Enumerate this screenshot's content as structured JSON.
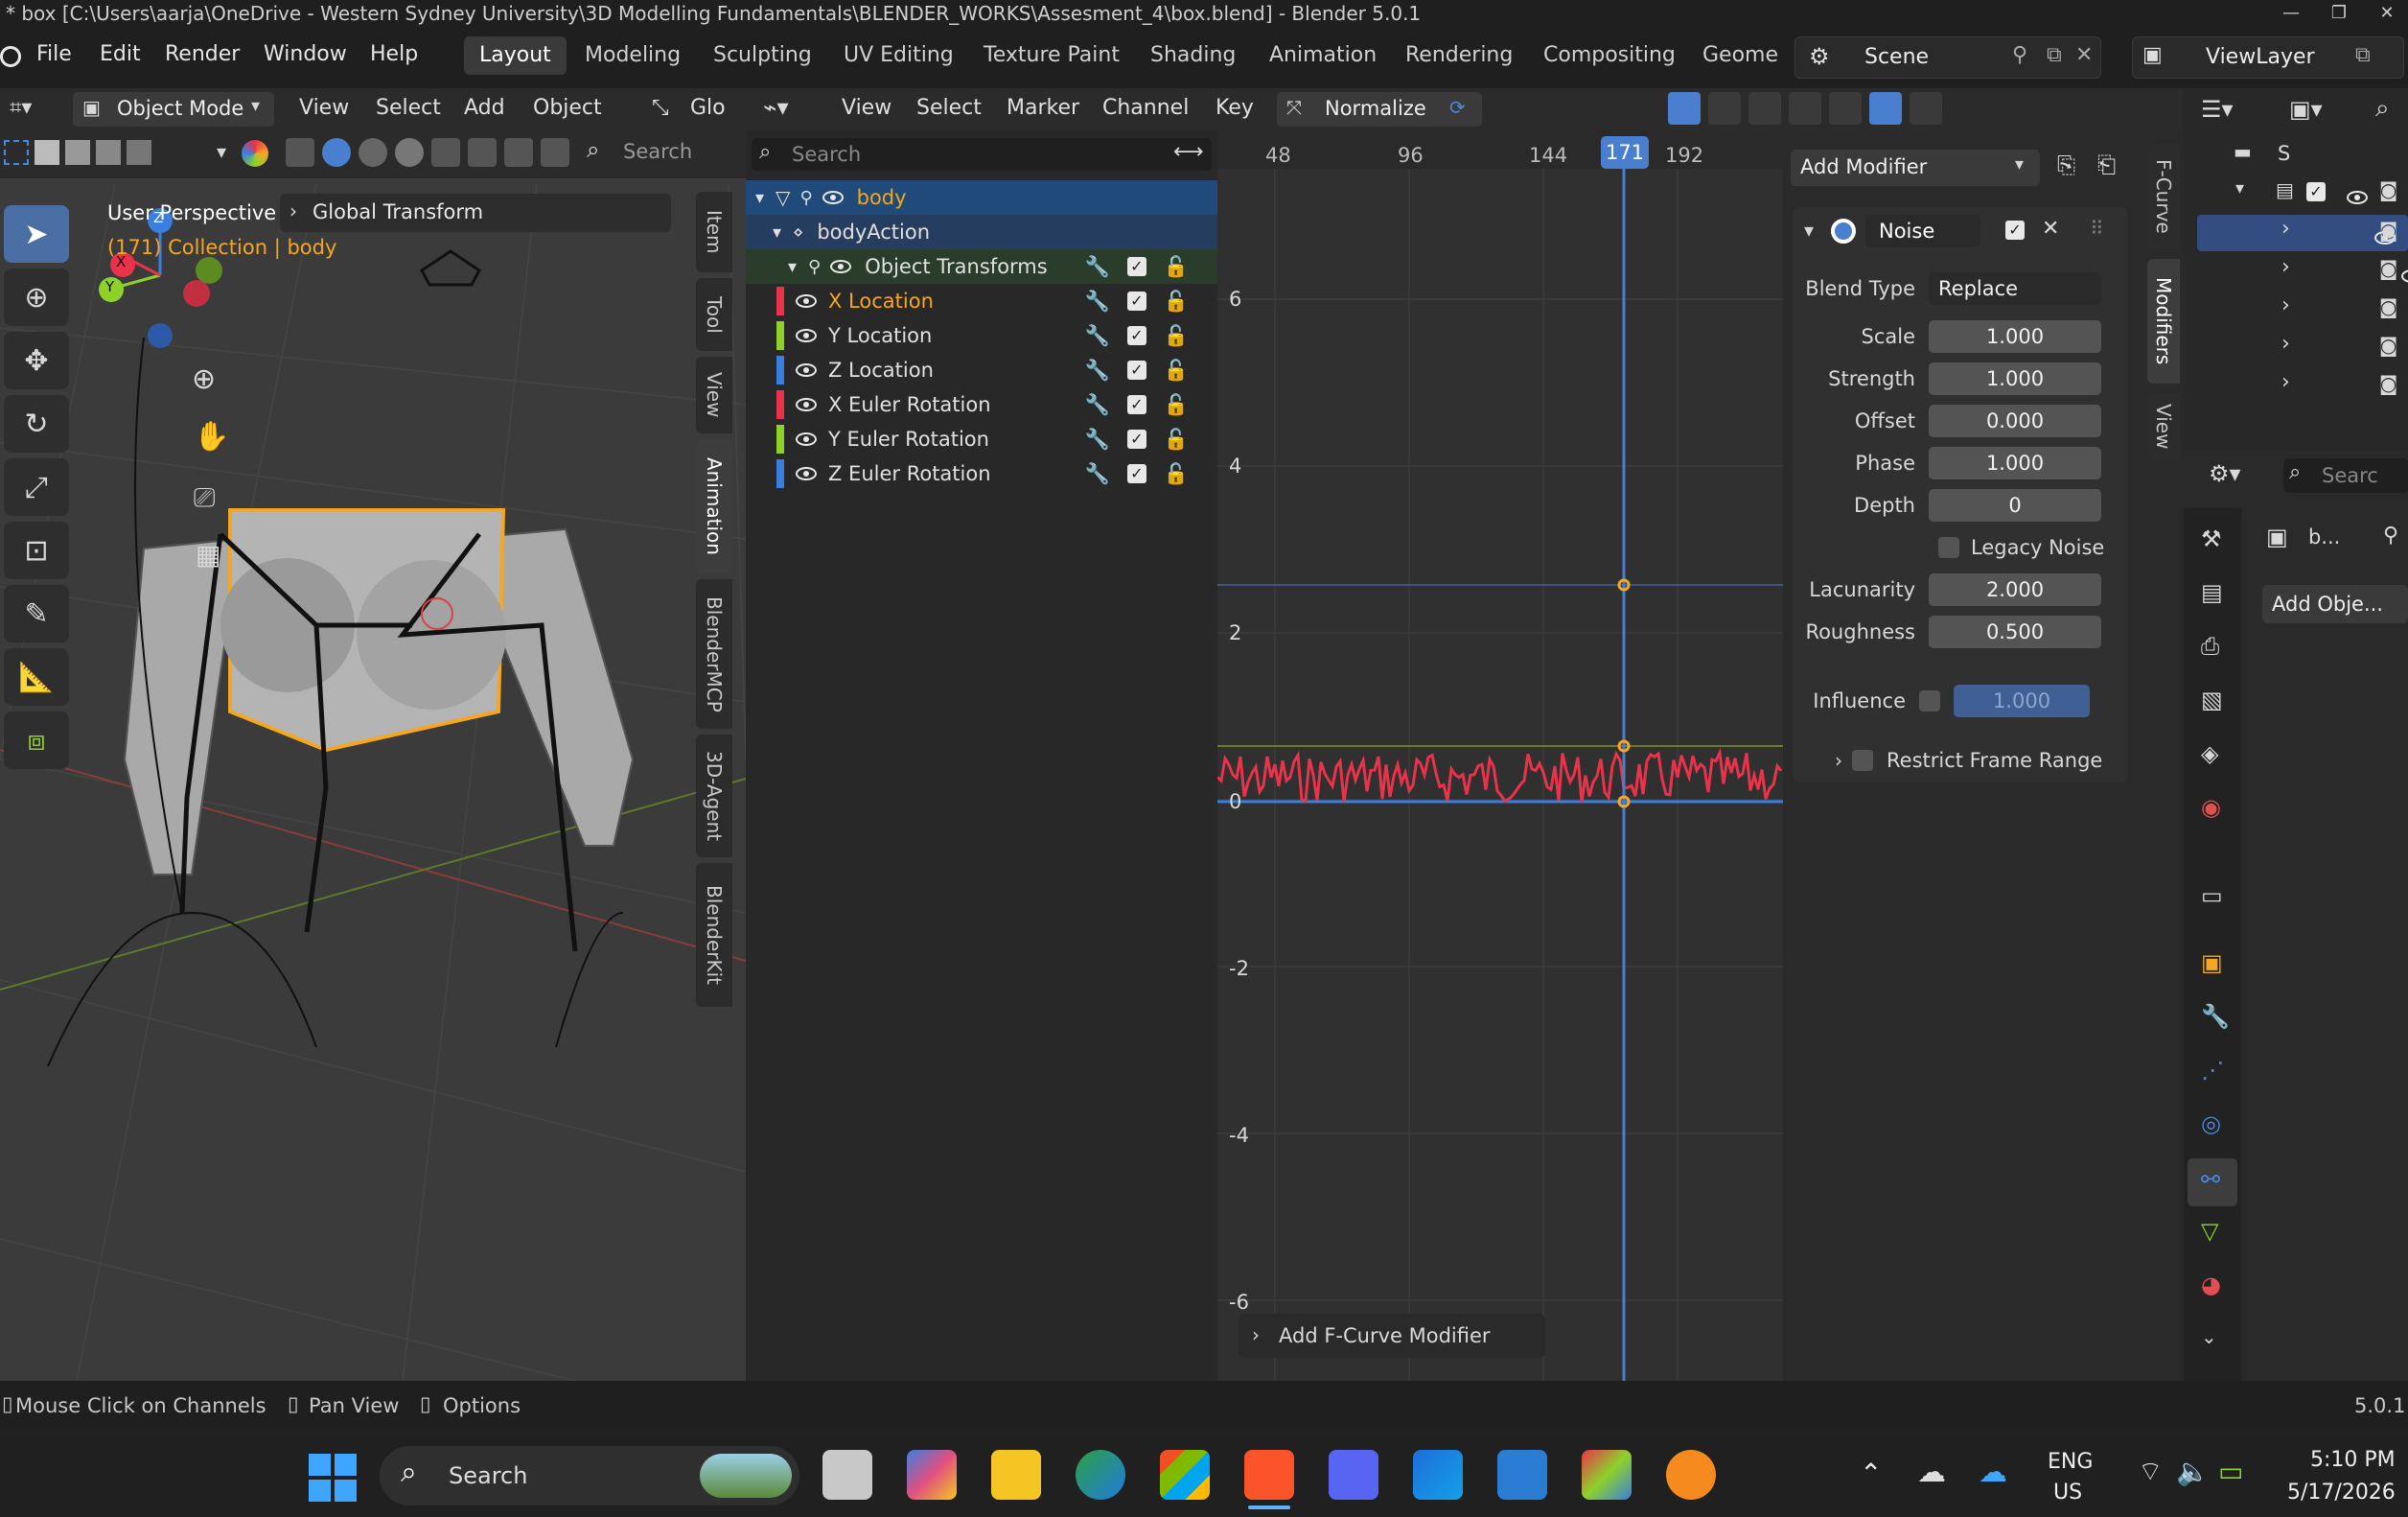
{
  "titlebar": {
    "title": "* box [C:\\Users\\aarja\\OneDrive - Western Sydney University\\3D Modelling Fundamentals\\BLENDER_WORKS\\Assesment_4\\box.blend] - Blender 5.0.1",
    "minimize": "—",
    "maximize": "❐",
    "close": "✕"
  },
  "menu": {
    "items": [
      "File",
      "Edit",
      "Render",
      "Window",
      "Help"
    ],
    "workspaces": [
      "Layout",
      "Modeling",
      "Sculpting",
      "UV Editing",
      "Texture Paint",
      "Shading",
      "Animation",
      "Rendering",
      "Compositing",
      "Geome"
    ],
    "scene": "Scene",
    "view_layer": "ViewLayer"
  },
  "viewport": {
    "mode": "Object Mode",
    "menus": [
      "View",
      "Select",
      "Add",
      "Object"
    ],
    "transform_label": "Glo",
    "search_placeholder": "Search",
    "view_name": "User Perspective",
    "collection_line": "(171) Collection | body",
    "operator_panel": "Global Transform",
    "side_tabs": [
      "Item",
      "Tool",
      "View",
      "Animation",
      "BlenderMCP",
      "3D-Agent",
      "BlenderKit"
    ],
    "gizmo_labels": {
      "x": "X",
      "y": "Y",
      "z": "Z"
    }
  },
  "graph_editor": {
    "menus": [
      "View",
      "Select",
      "Marker",
      "Channel",
      "Key"
    ],
    "normalize": "Normalize",
    "search_placeholder": "Search",
    "channels": {
      "object": "body",
      "action": "bodyAction",
      "group": "Object Transforms",
      "curves": [
        {
          "label": "X Location",
          "color": "#e8334a",
          "selected": true
        },
        {
          "label": "Y Location",
          "color": "#8ed12b",
          "selected": false
        },
        {
          "label": "Z Location",
          "color": "#3a7ee0",
          "selected": false
        },
        {
          "label": "X Euler Rotation",
          "color": "#e8334a",
          "selected": false
        },
        {
          "label": "Y Euler Rotation",
          "color": "#8ed12b",
          "selected": false
        },
        {
          "label": "Z Euler Rotation",
          "color": "#3a7ee0",
          "selected": false
        }
      ]
    },
    "frame_ticks": [
      "48",
      "96",
      "144",
      "192"
    ],
    "current_frame": "171",
    "value_ticks": [
      "6",
      "4",
      "2",
      "0",
      "-2",
      "-4",
      "-6"
    ],
    "add_fcurve_modifier": "Add F-Curve Modifier",
    "side_tabs": [
      "F-Curve",
      "Modifiers",
      "View"
    ]
  },
  "modifier_panel": {
    "add_modifier": "Add Modifier",
    "name": "Noise",
    "blend_type_label": "Blend Type",
    "blend_type": "Replace",
    "props": [
      {
        "label": "Scale",
        "value": "1.000"
      },
      {
        "label": "Strength",
        "value": "1.000"
      },
      {
        "label": "Offset",
        "value": "0.000"
      },
      {
        "label": "Phase",
        "value": "1.000"
      },
      {
        "label": "Depth",
        "value": "0"
      }
    ],
    "legacy_noise": "Legacy Noise",
    "props2": [
      {
        "label": "Lacunarity",
        "value": "2.000"
      },
      {
        "label": "Roughness",
        "value": "0.500"
      }
    ],
    "influence_label": "Influence",
    "influence_value": "1.000",
    "restrict_frame_range": "Restrict Frame Range"
  },
  "outliner": {
    "root": "S",
    "search_placeholder": "Searc",
    "object_short": "b...",
    "add_object": "Add Obje..."
  },
  "statusbar": {
    "hints": [
      "Mouse Click on Channels",
      "Pan View",
      "Options"
    ],
    "version": "5.0.1"
  },
  "taskbar": {
    "search": "Search",
    "lang1": "ENG",
    "lang2": "US",
    "time": "5:10 PM",
    "date": "5/17/2026"
  },
  "colors": {
    "accent": "#4a7fcf",
    "selection_orange": "#f5a623",
    "curve_red": "#e8334a"
  }
}
